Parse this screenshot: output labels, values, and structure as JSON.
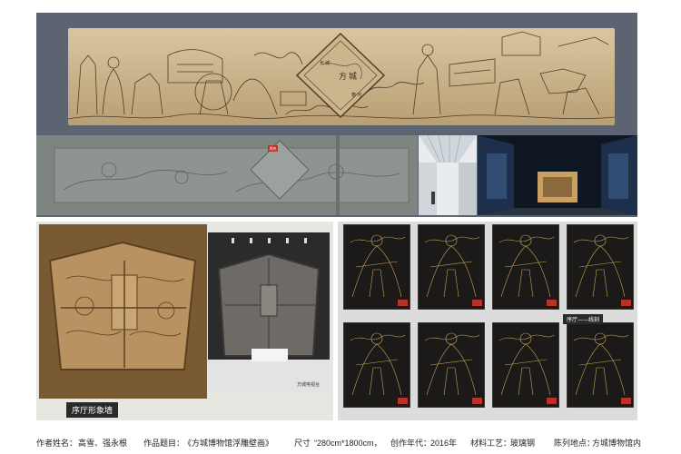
{
  "mural": {
    "diamond_text_1": "方",
    "diamond_text_2": "城",
    "diamond_text_3": "长",
    "diamond_text_4": "城",
    "diamond_text_5": "春",
    "diamond_text_6": "河"
  },
  "labels": {
    "foyer_wall": "序厅形象墙",
    "linework": "序厅——线刻",
    "wechat_mark": "方城电视台",
    "stamp": "郑杰"
  },
  "footer": {
    "author_label": "作者姓名：",
    "author_value": "高雪、强永根",
    "title_label": "作品题目：",
    "title_value": "《方城博物馆浮雕壁画》",
    "size_label": "尺寸 ",
    "size_value": "“280cm*1800cm，",
    "year_label": "创作年代：",
    "year_value": "2016年",
    "material_label": "材料工艺：",
    "material_value": "玻璃钢",
    "location_label": "陈列地点：",
    "location_value": "方城博物馆内"
  },
  "colors": {
    "slate_panel": "#5b6470",
    "mural_beige": "#c9b48f",
    "mural_dark": "#5a4630",
    "bronze": "#8b6a3a",
    "engraving_black": "#1b1a18",
    "engraving_gold": "#c8a45a"
  }
}
